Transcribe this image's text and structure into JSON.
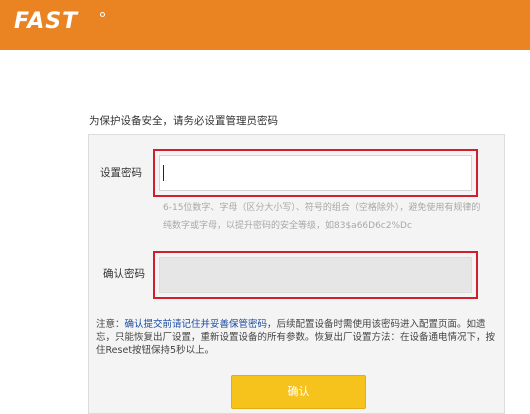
{
  "header": {
    "logo_text": "FAST",
    "brand_color": "#ea8423"
  },
  "intro_text": "为保护设备安全，请务必设置管理员密码",
  "form": {
    "password_label": "设置密码",
    "password_value": "",
    "hint_text": "6-15位数字、字母（区分大小写）、符号的组合（空格除外），避免使用有规律的纯数字或字母，以提升密码的安全等级，如83$a66D6c2%Dc",
    "confirm_label": "确认密码",
    "confirm_value": "",
    "highlight_color": "#cf1f2e"
  },
  "notice": {
    "prefix": "注意：",
    "highlight": "确认提交前请记住并妥善保管密码",
    "rest": "，后续配置设备时需使用该密码进入配置页面。如遗忘，只能恢复出厂设置，重新设置设备的所有参数。恢复出厂设置方法：在设备通电情况下，按住Reset按钮保持5秒以上。"
  },
  "buttons": {
    "confirm_label": "确认",
    "confirm_color": "#f6c21c"
  }
}
